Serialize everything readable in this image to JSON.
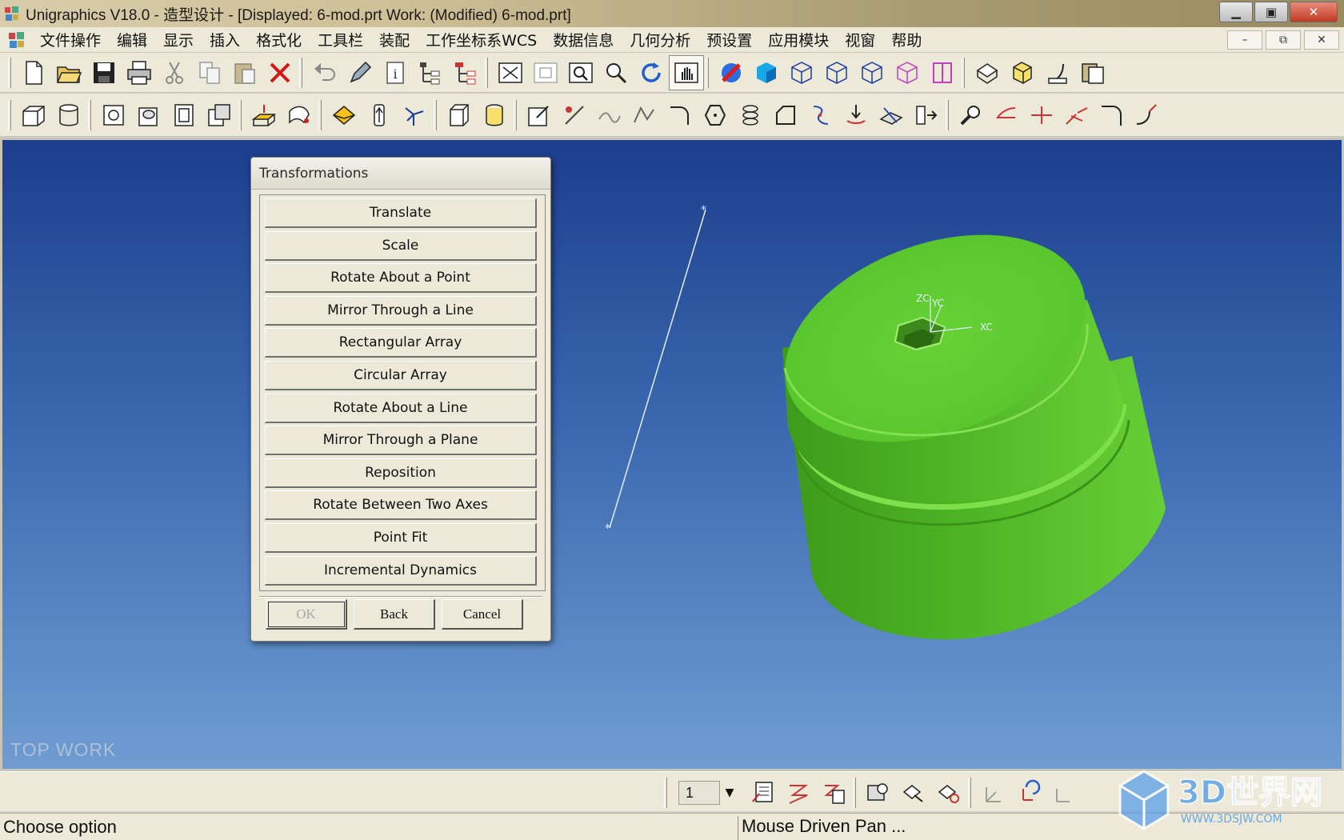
{
  "window": {
    "title": "Unigraphics V18.0 - 造型设计 - [Displayed: 6-mod.prt   Work:  (Modified) 6-mod.prt]",
    "controls": {
      "minimize": "▁",
      "maximize": "▣",
      "close": "✕"
    }
  },
  "menubar": {
    "items": [
      "文件操作",
      "编辑",
      "显示",
      "插入",
      "格式化",
      "工具栏",
      "装配",
      "工作坐标系WCS",
      "数据信息",
      "几何分析",
      "预设置",
      "应用模块",
      "视窗",
      "帮助"
    ],
    "mdi_controls": {
      "minimize": "–",
      "restore": "⧉",
      "close": "✕"
    }
  },
  "toolbar_row1": {
    "icons": [
      "new-file-icon",
      "open-folder-icon",
      "save-icon",
      "print-icon",
      "cut-icon",
      "copy-icon",
      "paste-icon",
      "delete-icon",
      "undo-icon",
      "edit-object-icon",
      "info-icon",
      "assembly-tree-icon",
      "part-navigator-icon",
      "fit-view-icon",
      "zoom-window-icon",
      "zoom-region-icon",
      "zoom-in-icon",
      "rotate-view-icon",
      "pan-view-icon",
      "shaded-edge-icon",
      "shaded-icon",
      "wireframe-icon",
      "hidden-line-icon",
      "static-wireframe-icon",
      "face-analysis-icon",
      "iso-view-icon",
      "top-view-icon",
      "front-view-icon",
      "section-view-icon"
    ]
  },
  "toolbar_row2": {
    "icons": [
      "feature-block-icon",
      "feature-cylinder-icon",
      "hole-icon",
      "boss-icon",
      "pocket-icon",
      "pad-icon",
      "extrude-icon",
      "revolve-icon",
      "sweep-icon",
      "tube-icon",
      "datum-icon",
      "solid-box-icon",
      "solid-cylinder-icon",
      "sketch-icon",
      "line-icon",
      "spline-icon",
      "polyline-icon",
      "arc-icon",
      "polygon-icon",
      "helix-icon",
      "offset-curve-icon",
      "bridge-curve-icon",
      "project-curve-icon",
      "intersect-curve-icon",
      "extract-curve-icon",
      "curve-edit-icon",
      "trim-icon",
      "divide-icon",
      "fillet-curve-icon",
      "corner-icon",
      "extend-curve-icon"
    ]
  },
  "viewport": {
    "view_label": "TOP WORK",
    "model_color": "#5cc22e",
    "background_top": "#1c3e8c",
    "background_bottom": "#6f9dd2",
    "csys_labels": [
      "ZC",
      "YC",
      "XC"
    ]
  },
  "dialog": {
    "title": "Transformations",
    "options": [
      "Translate",
      "Scale",
      "Rotate About a Point",
      "Mirror Through a Line",
      "Rectangular Array",
      "Circular Array",
      "Rotate About a Line",
      "Mirror Through a Plane",
      "Reposition",
      "Rotate Between Two Axes",
      "Point Fit",
      "Incremental Dynamics"
    ],
    "buttons": {
      "ok": "OK",
      "back": "Back",
      "cancel": "Cancel"
    }
  },
  "bottom_toolbar": {
    "layer_value": "1",
    "icons": [
      "layer-settings-icon",
      "move-to-layer-icon",
      "copy-to-layer-icon",
      "view-layout-icon",
      "orient-view-icon",
      "replace-view-icon",
      "wcs-dynamics-icon",
      "wcs-rotate-icon",
      "wcs-origin-icon",
      "wcs-save-icon",
      "wcs-display-icon"
    ]
  },
  "statusbar": {
    "prompt": "Choose option",
    "status": "Mouse Driven Pan ..."
  },
  "watermark": {
    "brand": "3D世界网",
    "url": "WWW.3DSJW.COM"
  }
}
